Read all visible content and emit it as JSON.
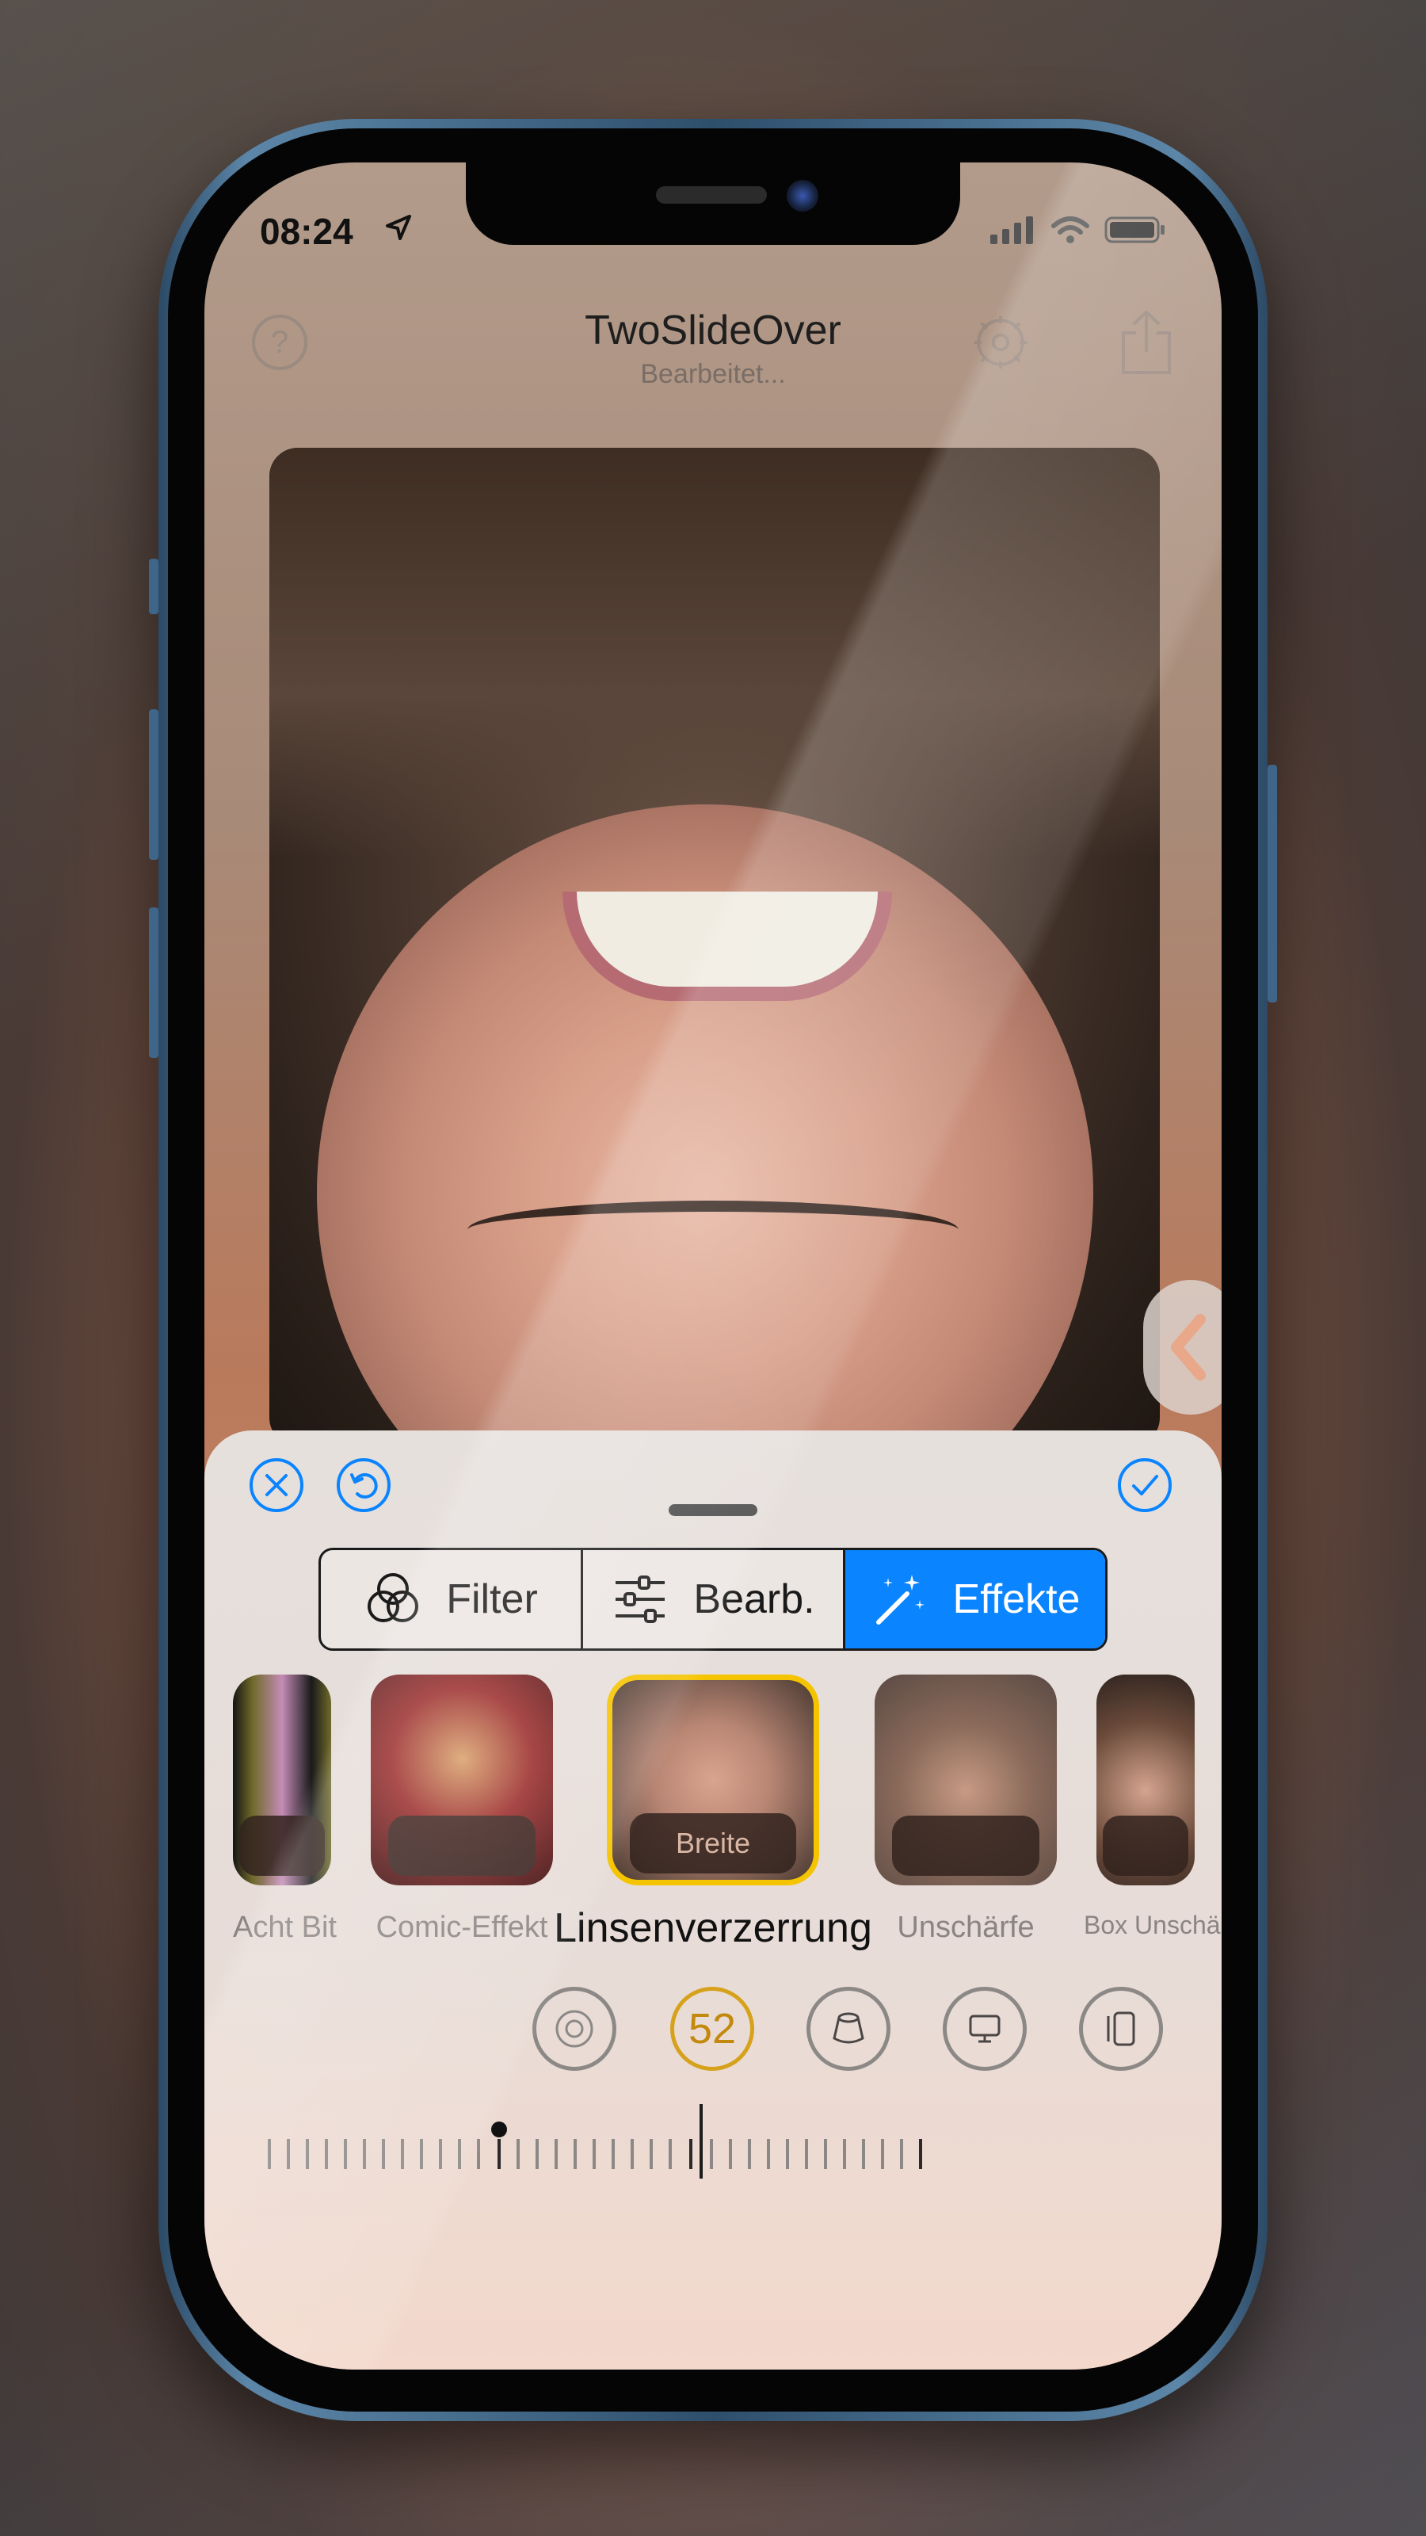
{
  "status_bar": {
    "time": "08:24"
  },
  "nav": {
    "title": "TwoSlideOver",
    "subtitle": "Bearbeitet..."
  },
  "segments": [
    {
      "label": "Filter",
      "icon": "three-circles-icon",
      "active": false
    },
    {
      "label": "Bearb.",
      "icon": "sliders-icon",
      "active": false
    },
    {
      "label": "Effekte",
      "icon": "magic-wand-icon",
      "active": true
    }
  ],
  "effects": [
    {
      "label": "Acht Bit"
    },
    {
      "label": "Comic-Effekt"
    },
    {
      "label": "Linsenverzerrung",
      "pill": "Breite",
      "selected": true
    },
    {
      "label": "Unschärfe"
    },
    {
      "label": "Box Unschärfe"
    }
  ],
  "params": {
    "active_value": "52"
  },
  "colors": {
    "accent": "#0a84ff",
    "selection": "#f5c400",
    "value": "#c2890d"
  }
}
